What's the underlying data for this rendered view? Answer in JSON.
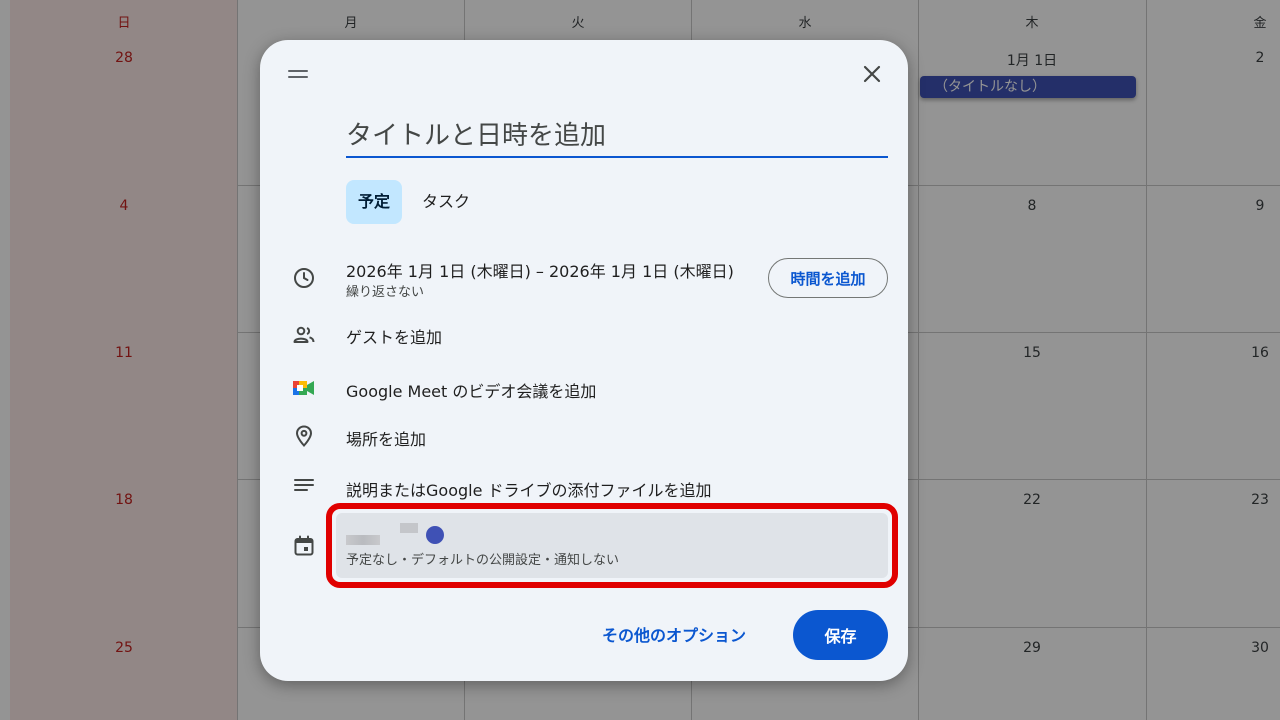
{
  "calendar": {
    "weekday_headers": [
      "日",
      "月",
      "火",
      "水",
      "木",
      "金"
    ],
    "weeks": [
      {
        "days": [
          "28",
          "",
          "",
          "",
          "1月 1日",
          "2"
        ]
      },
      {
        "days": [
          "4",
          "",
          "",
          "",
          "8",
          "9"
        ]
      },
      {
        "days": [
          "11",
          "",
          "",
          "",
          "15",
          "16"
        ]
      },
      {
        "days": [
          "18",
          "",
          "",
          "",
          "22",
          "23"
        ]
      },
      {
        "days": [
          "25",
          "",
          "",
          "",
          "29",
          "30"
        ]
      }
    ],
    "event_chip": "（タイトルなし）"
  },
  "dialog": {
    "title_placeholder": "タイトルと日時を追加",
    "tabs": [
      {
        "label": "予定",
        "active": true
      },
      {
        "label": "タスク",
        "active": false
      }
    ],
    "datetime": {
      "range": "2026年 1月 1日 (木曜日)  –  2026年 1月 1日 (木曜日)",
      "repeat": "繰り返さない",
      "add_time_label": "時間を追加"
    },
    "add_guests": "ゲストを追加",
    "add_meet": "Google Meet のビデオ会議を追加",
    "add_location": "場所を追加",
    "add_description": "説明またはGoogle ドライブの添付ファイルを追加",
    "calendar_selector": {
      "subtitle": "予定なし・デフォルトの公開設定・通知しない",
      "dot_color": "#3f51b5",
      "highlight_color": "#e00000"
    },
    "more_options_label": "その他のオプション",
    "save_label": "保存"
  }
}
